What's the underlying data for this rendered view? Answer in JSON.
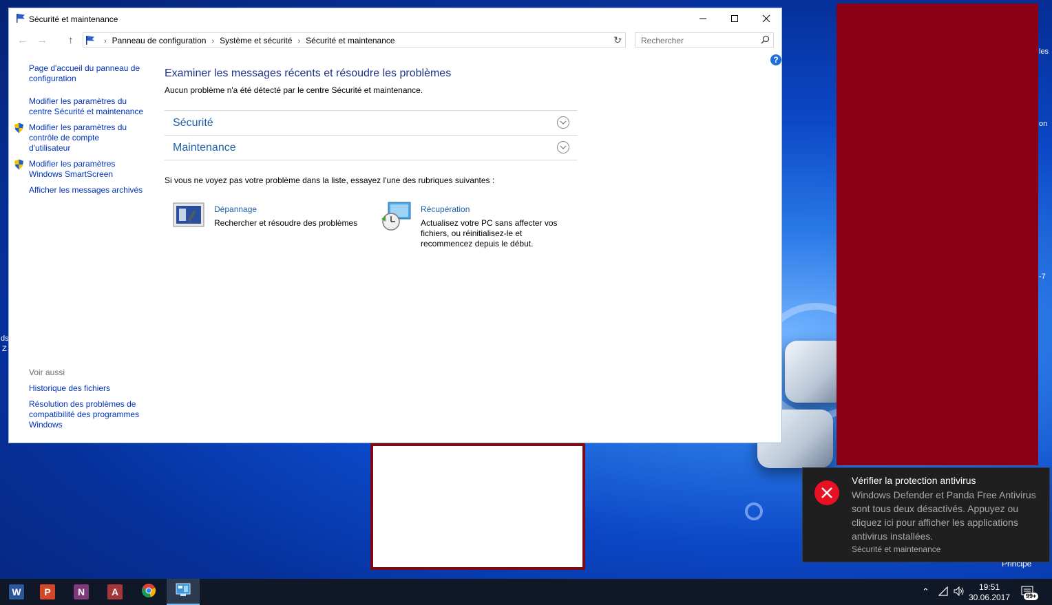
{
  "window": {
    "title": "Sécurité et maintenance",
    "breadcrumb": [
      "Panneau de configuration",
      "Système et sécurité",
      "Sécurité et maintenance"
    ],
    "search_placeholder": "Rechercher"
  },
  "sidebar": {
    "links": [
      "Page d'accueil du panneau de configuration",
      "Modifier les paramètres du centre Sécurité et maintenance",
      "Modifier les paramètres du contrôle de compte d'utilisateur",
      "Modifier les paramètres Windows SmartScreen",
      "Afficher les messages archivés"
    ],
    "see_also_heading": "Voir aussi",
    "see_also": [
      "Historique des fichiers",
      "Résolution des problèmes de compatibilité des programmes Windows"
    ]
  },
  "main": {
    "heading": "Examiner les messages récents et résoudre les problèmes",
    "subheading": "Aucun problème n'a été détecté par le centre Sécurité et maintenance.",
    "sections": [
      "Sécurité",
      "Maintenance"
    ],
    "hint": "Si vous ne voyez pas votre problème dans la liste, essayez l'une des rubriques suivantes :",
    "troubleshoot": {
      "title": "Dépannage",
      "desc": "Rechercher et résoudre des problèmes"
    },
    "recovery": {
      "title": "Récupération",
      "desc": "Actualisez votre PC sans affecter vos fichiers, ou réinitialisez-le et recommencez depuis le début."
    }
  },
  "toast": {
    "title": "Vérifier la protection antivirus",
    "body": "Windows Defender et Panda Free Antivirus sont tous deux désactivés. Appuyez ou cliquez ici pour afficher les applications antivirus installées.",
    "source": "Sécurité et maintenance"
  },
  "desktop": {
    "edge_labels": [
      "les",
      "on",
      "-7",
      "ds",
      "Z"
    ],
    "principe_label": "Principe"
  },
  "taskbar": {
    "apps": [
      {
        "name": "word",
        "letter": "W",
        "color": "#2b579a"
      },
      {
        "name": "powerpoint",
        "letter": "P",
        "color": "#d24726"
      },
      {
        "name": "onenote",
        "letter": "N",
        "color": "#80397b"
      },
      {
        "name": "access",
        "letter": "A",
        "color": "#a4373a"
      },
      {
        "name": "chrome",
        "letter": "",
        "color": "#ffffff"
      },
      {
        "name": "control-panel",
        "letter": "",
        "color": "#3a96dd"
      }
    ],
    "time": "19:51",
    "date": "30.06.2017",
    "notification_count": "99+"
  }
}
